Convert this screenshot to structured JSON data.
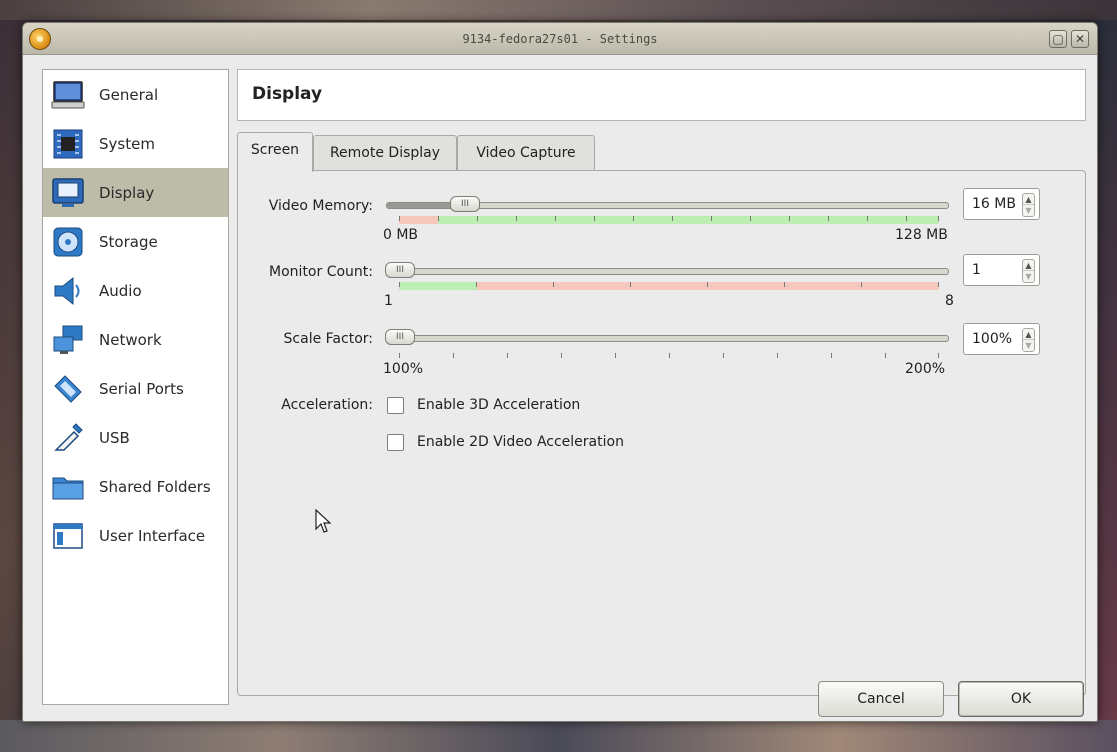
{
  "window": {
    "title": "9134-fedora27s01 - Settings"
  },
  "sidebar": {
    "items": [
      {
        "label": "General",
        "icon": "monitor-icon"
      },
      {
        "label": "System",
        "icon": "chip-icon"
      },
      {
        "label": "Display",
        "icon": "display-icon",
        "selected": true
      },
      {
        "label": "Storage",
        "icon": "disk-icon"
      },
      {
        "label": "Audio",
        "icon": "speaker-icon"
      },
      {
        "label": "Network",
        "icon": "network-icon"
      },
      {
        "label": "Serial Ports",
        "icon": "serial-port-icon"
      },
      {
        "label": "USB",
        "icon": "usb-icon"
      },
      {
        "label": "Shared Folders",
        "icon": "folder-icon"
      },
      {
        "label": "User Interface",
        "icon": "window-icon"
      }
    ]
  },
  "header": {
    "title": "Display"
  },
  "tabs": [
    {
      "label": "Screen",
      "active": true
    },
    {
      "label": "Remote Display",
      "active": false
    },
    {
      "label": "Video Capture",
      "active": false
    }
  ],
  "screen": {
    "video_memory": {
      "label": "Video Memory:",
      "min_label": "0 MB",
      "max_label": "128 MB",
      "value": "16 MB",
      "position": 0.125
    },
    "monitor_count": {
      "label": "Monitor Count:",
      "min_label": "1",
      "max_label": "8",
      "value": "1",
      "position": 0.0
    },
    "scale_factor": {
      "label": "Scale Factor:",
      "min_label": "100%",
      "max_label": "200%",
      "value": "100%",
      "position": 0.0
    },
    "acceleration": {
      "label": "Acceleration:",
      "options": [
        {
          "label": "Enable 3D Acceleration",
          "checked": false
        },
        {
          "label": "Enable 2D Video Acceleration",
          "checked": false
        }
      ]
    }
  },
  "buttons": {
    "cancel": "Cancel",
    "ok": "OK"
  },
  "colors": {
    "selected_item": "#bcbca9",
    "range_green": "#bdeeb4",
    "range_red": "#f6c8bd"
  }
}
